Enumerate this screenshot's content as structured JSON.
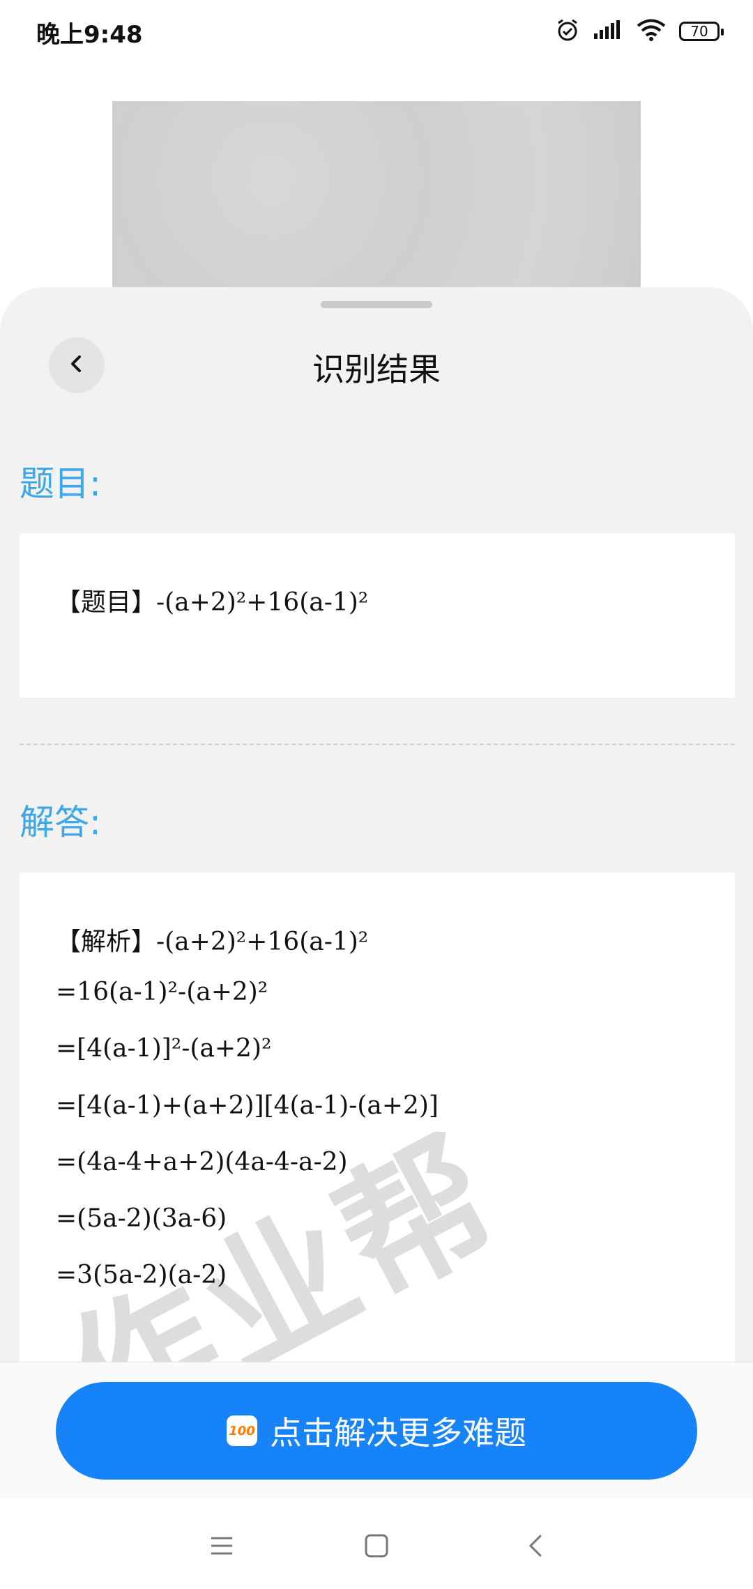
{
  "status_bar": {
    "time": "晚上9:48",
    "battery": "70",
    "icons": [
      "alarm-icon",
      "signal-icon",
      "wifi-icon",
      "battery-icon"
    ]
  },
  "sheet": {
    "title": "识别结果",
    "back_icon": "chevron-left-icon"
  },
  "question": {
    "label": "题目:",
    "text": "【题目】-(a+2)²+16(a-1)²"
  },
  "answer": {
    "label": "解答:",
    "lines": [
      "【解析】-(a+2)²+16(a-1)²",
      "=16(a-1)²-(a+2)²",
      "=[4(a-1)]²-(a+2)²",
      "=[4(a-1)+(a+2)][4(a-1)-(a+2)]",
      "=(4a-4+a+2)(4a-4-a-2)",
      "=(5a-2)(3a-6)",
      "=3(5a-2)(a-2)"
    ],
    "watermark": "作业帮"
  },
  "action": {
    "button_label": "点击解决更多难题",
    "logo_text": "100"
  },
  "nav": {
    "items": [
      "menu-icon",
      "home-square-icon",
      "back-icon"
    ]
  },
  "colors": {
    "accent_blue": "#1683f8",
    "label_blue": "#3ea7e8",
    "sheet_bg": "#f2f2f2"
  }
}
